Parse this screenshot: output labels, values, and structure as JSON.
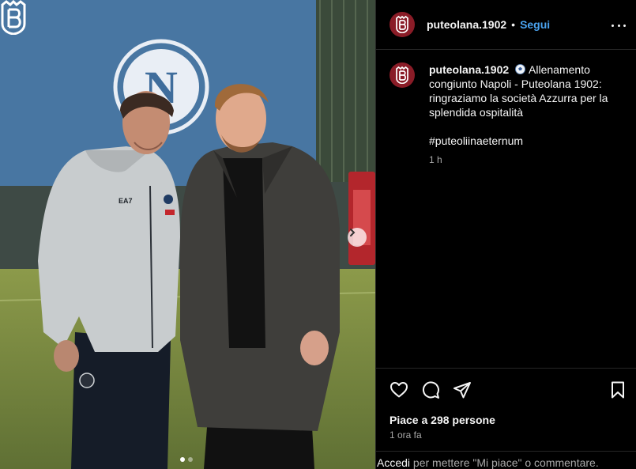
{
  "post": {
    "username": "puteolana.1902",
    "separator": "•",
    "follow_label": "Segui",
    "caption_text": "Allenamento congiunto Napoli - Puteolana 1902: ringraziamo la società Azzurra per la splendida ospitalità",
    "hashtag": "#puteoliinaeternum",
    "caption_time": "1 h",
    "likes": "Piace a 298 persone",
    "time_ago": "1 ora fa",
    "login_link": "Accedi",
    "login_prompt": " per mettere \"Mi piace\" o commentare."
  },
  "photo": {
    "banner_letter": "N",
    "jacket_brand": "EA7",
    "carousel": {
      "total": 2,
      "active": 1
    }
  },
  "icons": [
    "puteolana-crest-icon",
    "more-options-icon",
    "soccer-ball-icon",
    "heart-icon",
    "comment-icon",
    "share-icon",
    "bookmark-icon",
    "chevron-right-icon"
  ],
  "colors": {
    "follow_blue": "#4aa3f0",
    "brand_red": "#8a1c27",
    "napoli_blue": "#3f6d9c"
  }
}
